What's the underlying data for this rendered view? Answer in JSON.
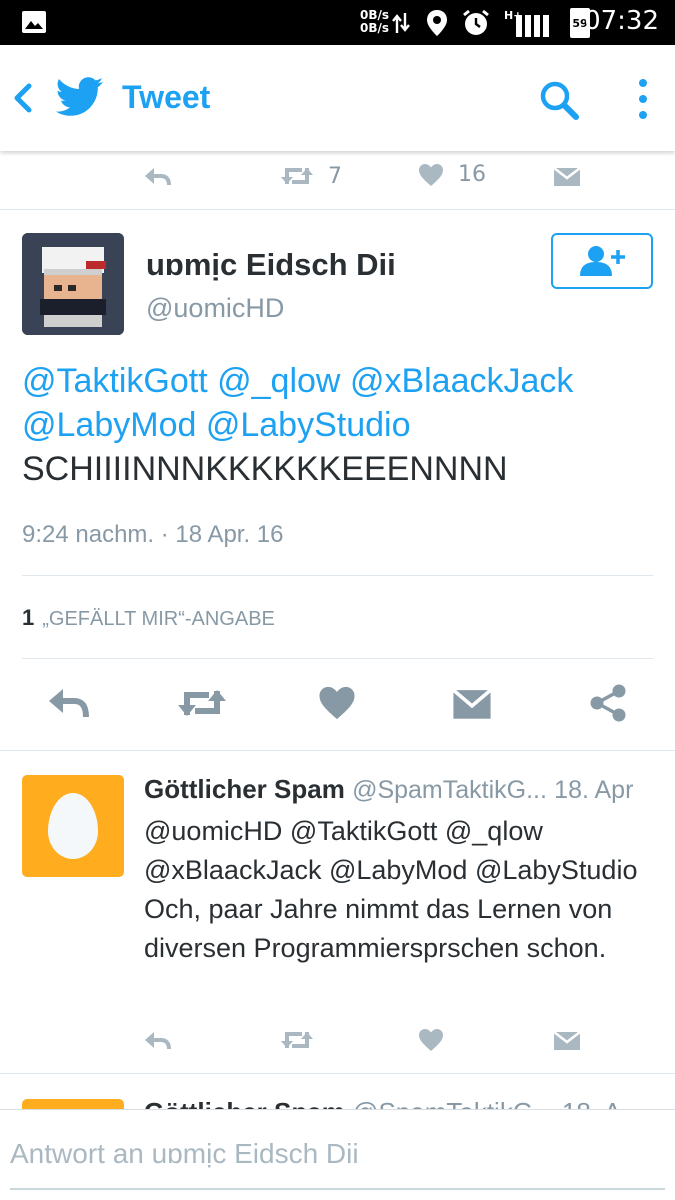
{
  "status_bar": {
    "net_up": "0B/s",
    "net_down": "0B/s",
    "signal_type": "H+",
    "battery_level": "59",
    "time": "07:32",
    "icons": [
      "image-icon",
      "data-transfer-icon",
      "location-icon",
      "alarm-icon",
      "signal-icon",
      "battery-icon"
    ]
  },
  "app_bar": {
    "title": "Tweet",
    "icons": [
      "back-arrow-icon",
      "twitter-bird-icon",
      "search-icon",
      "more-vert-icon"
    ]
  },
  "previous_tweet_actions": {
    "retweet_count": "7",
    "like_count": "16"
  },
  "main_tweet": {
    "author_name": "uɒmịc Eidsch Dii",
    "author_handle": "@uomicHD",
    "mentions_line1": [
      "@TaktikGott",
      "@_qlow",
      "@xBlaackJack"
    ],
    "mentions_line2": [
      "@LabyMod",
      "@LabyStudio"
    ],
    "body": "SCHIIIINNNKKKKKKEEENNNN",
    "timestamp": "9:24 nachm. · 18 Apr. 16",
    "likes_count": "1",
    "likes_label": "„GEFÄLLT MIR“-ANGABE"
  },
  "reply_tweet": {
    "author_name": "Göttlicher Spam",
    "author_handle": "@SpamTaktikG...",
    "date": "18. Apr",
    "text": "@uomicHD @TaktikGott @_qlow @xBlaackJack @LabyMod @LabyStudio Och, paar Jahre nimmt das Lernen von diversen Programmiersprschen schon."
  },
  "partial_tweet": {
    "author_name": "Göttlicher Spam",
    "author_handle": "@SpamTaktikG...",
    "date": "18. A"
  },
  "composer": {
    "placeholder": "Antwort an uɒmịc Eidsch Dii"
  },
  "colors": {
    "accent": "#1da1f2",
    "muted_text": "#8899a6",
    "icon_gray": "#aab8c2",
    "egg_background": "#ffad1f"
  }
}
